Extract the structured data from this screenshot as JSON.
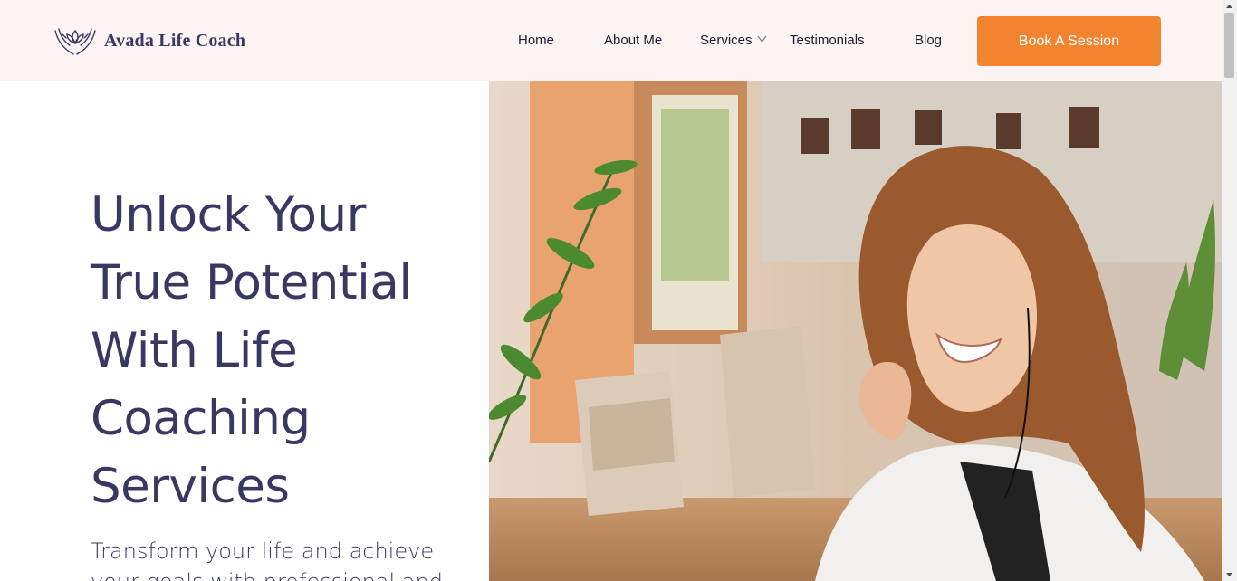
{
  "brand": {
    "name": "Avada Life Coach",
    "icon": "lotus-hands-icon"
  },
  "nav": {
    "items": [
      {
        "label": "Home"
      },
      {
        "label": "About Me"
      },
      {
        "label": "Services",
        "has_dropdown": true
      },
      {
        "label": "Testimonials"
      },
      {
        "label": "Blog"
      }
    ],
    "cta_label": "Book A Session"
  },
  "hero": {
    "title": "Unlock Your True Potential With Life Coaching Services",
    "subtitle": "Transform your life and achieve your goals with professional and"
  },
  "colors": {
    "header_bg": "#fbf4f3",
    "primary_text": "#393863",
    "accent": "#f2842f"
  }
}
